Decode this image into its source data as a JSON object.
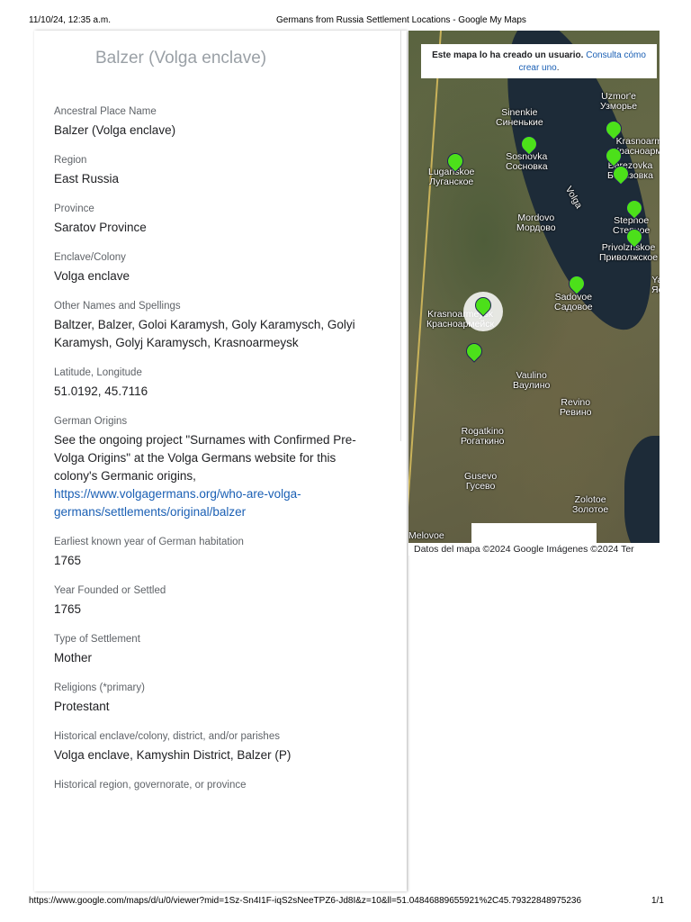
{
  "print_header": {
    "datetime": "11/10/24, 12:35 a.m.",
    "page_title": "Germans from Russia Settlement Locations - Google My Maps"
  },
  "print_footer": {
    "url": "https://www.google.com/maps/d/u/0/viewer?mid=1Sz-Sn4I1F-iqS2sNeeTPZ6-Jd8I&z=10&ll=51.04846889655921%2C45.79322848975236",
    "page": "1/1"
  },
  "panel": {
    "title": "Balzer (Volga enclave)",
    "fields": [
      {
        "label": "Ancestral Place Name",
        "value": "Balzer (Volga enclave)"
      },
      {
        "label": "Region",
        "value": "East Russia"
      },
      {
        "label": "Province",
        "value": "Saratov Province"
      },
      {
        "label": "Enclave/Colony",
        "value": "Volga enclave"
      },
      {
        "label": "Other Names and Spellings",
        "value": "Baltzer, Balzer, Goloi Karamysh, Goly Karamysch, Golyi Karamysh, Golyj Karamysch, Krasnoarmeysk"
      },
      {
        "label": "Latitude, Longitude",
        "value": "51.0192, 45.7116"
      },
      {
        "label": "German Origins",
        "value": "See the ongoing project \"Surnames with Confirmed Pre-Volga Origins\" at the Volga Germans website for this colony's Germanic origins,",
        "link": "https://www.volgagermans.org/who-are-volga-germans/settlements/original/balzer"
      },
      {
        "label": "Earliest known year of German habitation",
        "value": "1765"
      },
      {
        "label": "Year Founded or Settled",
        "value": "1765"
      },
      {
        "label": "Type of Settlement",
        "value": "Mother"
      },
      {
        "label": "Religions (*primary)",
        "value": "Protestant"
      },
      {
        "label": "Historical enclave/colony, district, and/or parishes",
        "value": "Volga enclave, Kamyshin District, Balzer (P)"
      },
      {
        "label": "Historical region, governorate, or province"
      }
    ]
  },
  "map": {
    "notice": "Este mapa lo ha creado un usuario.",
    "notice_link": "Consulta cómo crear uno",
    "attribution": "Datos del mapa ©2024 Google Imágenes ©2024 Ter",
    "labels": [
      "Uzmor'e\nУзморье",
      "Sinenkie\nСиненькие",
      "Krasnoarmeiskoe\nКрасноармейское",
      "Sosnovka\nСосновка",
      "Luganskoe\nЛуганское",
      "Berezovka\nБерезовка",
      "Volga",
      "Mordovo\nМордово",
      "Stepnoe\nСтепное",
      "Privolzhskoe\nПриволжское",
      "Sadovoe\nСадовое",
      "Krasnoarmeysk\nКрасноармейск",
      "Vaulino\nВаулино",
      "Revino\nРевино",
      "Rogatkino\nРогаткино",
      "Gusevo\nГусево",
      "Zolotoe\nЗолотое",
      "Melovoe",
      "Ya\nЯс"
    ],
    "pin_color": "#4ce01a"
  }
}
